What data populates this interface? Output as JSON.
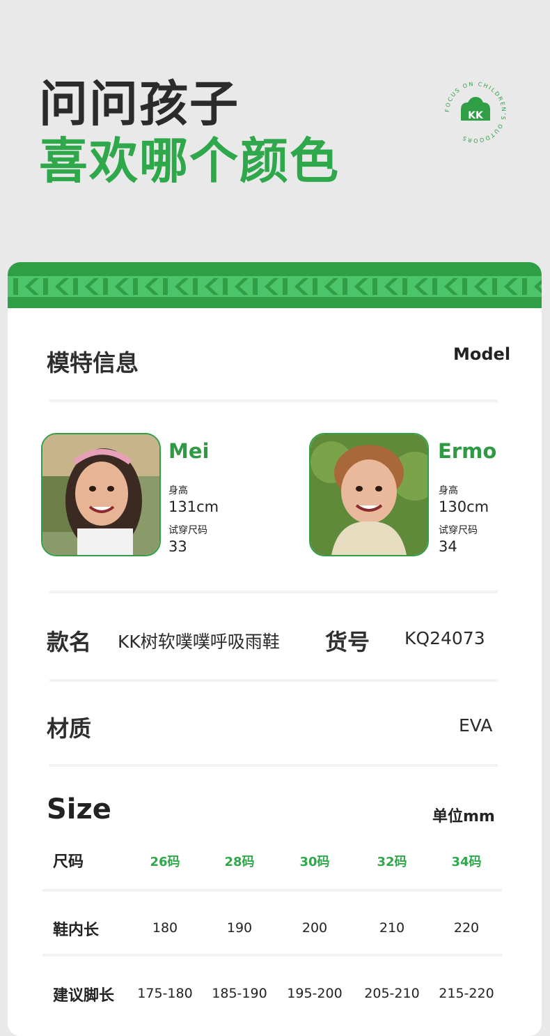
{
  "headline": {
    "line1": "问问孩子",
    "line2": "喜欢哪个颜色"
  },
  "badge": {
    "ring_text": "FOCUS ON CHILDREN'S OUTDOORS",
    "logo": "KK",
    "icon": "cloud-icon"
  },
  "colors": {
    "brand_green": "#2f9e45",
    "accent_green": "#2ea84a",
    "text_dark": "#2b2b2b"
  },
  "model_section": {
    "title": "模特信息",
    "title_en": "Model",
    "models": [
      {
        "name": "Mei",
        "height_label": "身高",
        "height": "131cm",
        "size_label": "试穿尺码",
        "size": "33"
      },
      {
        "name": "Ermo",
        "height_label": "身高",
        "height": "130cm",
        "size_label": "试穿尺码",
        "size": "34"
      }
    ]
  },
  "product": {
    "name_label": "款名",
    "name": "KK树软噗噗呼吸雨鞋",
    "sku_label": "货号",
    "sku": "KQ24073"
  },
  "material": {
    "label": "材质",
    "value": "EVA"
  },
  "size_table": {
    "title": "Size",
    "unit": "单位mm",
    "header_label": "尺码",
    "columns": [
      "26码",
      "28码",
      "30码",
      "32码",
      "34码"
    ],
    "rows": [
      {
        "label": "鞋内长",
        "values": [
          "180",
          "190",
          "200",
          "210",
          "220"
        ]
      },
      {
        "label": "建议脚长",
        "values": [
          "175-180",
          "185-190",
          "195-200",
          "205-210",
          "215-220"
        ]
      }
    ]
  }
}
